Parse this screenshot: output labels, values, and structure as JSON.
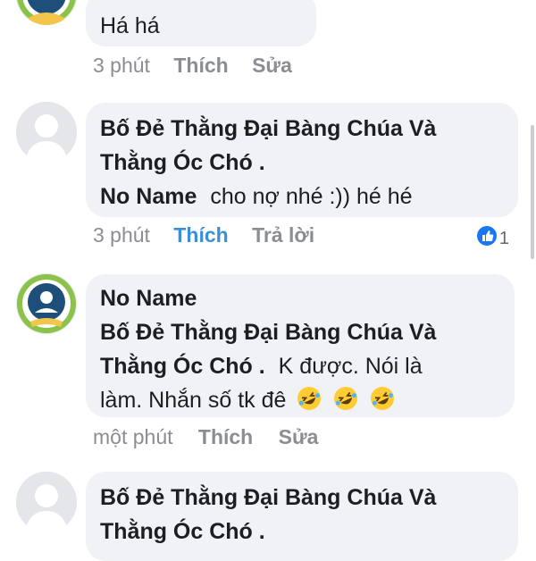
{
  "comments": [
    {
      "text": "Há há",
      "time": "3 phút",
      "like_label": "Thích",
      "second_action": "Sửa"
    },
    {
      "name_line1": "Bố Đẻ Thằng Đại Bàng Chúa Và",
      "name_line2": "Thằng Óc Chó .",
      "mention": "No Name",
      "text": "cho nợ nhé :)) hé hé",
      "time": "3 phút",
      "like_label": "Thích",
      "second_action": "Trả lời",
      "reaction_count": "1"
    },
    {
      "name": "No Name",
      "mention_line1": "Bố Đẻ Thằng Đại Bàng Chúa Và",
      "mention_line2": "Thằng Óc Chó .",
      "text_line1": "K được. Nói là",
      "text_line2": "làm. Nhắn số tk đê",
      "time": "một phút",
      "like_label": "Thích",
      "second_action": "Sửa"
    },
    {
      "name_line1": "Bố Đẻ Thằng Đại Bàng Chúa Và",
      "name_line2": "Thằng Óc Chó ."
    }
  ],
  "icons": {
    "reaction": "thumbs-up-icon",
    "emoji": "rolling-on-floor-laughing-emoji"
  },
  "colors": {
    "bubble": "#f0f2f5",
    "liked": "#3a8fd8",
    "muted": "#8a8d91"
  }
}
